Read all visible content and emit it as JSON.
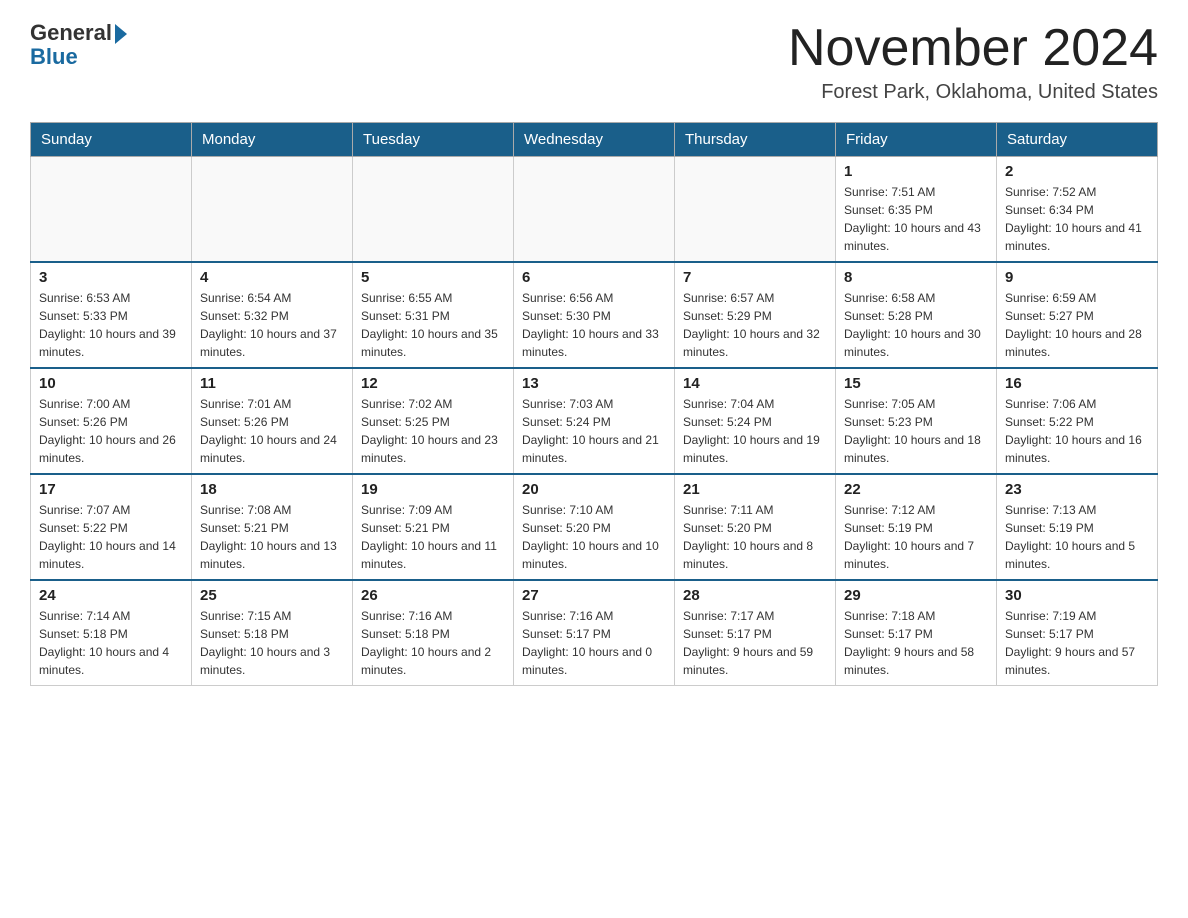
{
  "logo": {
    "general": "General",
    "blue": "Blue"
  },
  "header": {
    "title": "November 2024",
    "location": "Forest Park, Oklahoma, United States"
  },
  "days_of_week": [
    "Sunday",
    "Monday",
    "Tuesday",
    "Wednesday",
    "Thursday",
    "Friday",
    "Saturday"
  ],
  "weeks": [
    [
      {
        "day": "",
        "sunrise": "",
        "sunset": "",
        "daylight": ""
      },
      {
        "day": "",
        "sunrise": "",
        "sunset": "",
        "daylight": ""
      },
      {
        "day": "",
        "sunrise": "",
        "sunset": "",
        "daylight": ""
      },
      {
        "day": "",
        "sunrise": "",
        "sunset": "",
        "daylight": ""
      },
      {
        "day": "",
        "sunrise": "",
        "sunset": "",
        "daylight": ""
      },
      {
        "day": "1",
        "sunrise": "Sunrise: 7:51 AM",
        "sunset": "Sunset: 6:35 PM",
        "daylight": "Daylight: 10 hours and 43 minutes."
      },
      {
        "day": "2",
        "sunrise": "Sunrise: 7:52 AM",
        "sunset": "Sunset: 6:34 PM",
        "daylight": "Daylight: 10 hours and 41 minutes."
      }
    ],
    [
      {
        "day": "3",
        "sunrise": "Sunrise: 6:53 AM",
        "sunset": "Sunset: 5:33 PM",
        "daylight": "Daylight: 10 hours and 39 minutes."
      },
      {
        "day": "4",
        "sunrise": "Sunrise: 6:54 AM",
        "sunset": "Sunset: 5:32 PM",
        "daylight": "Daylight: 10 hours and 37 minutes."
      },
      {
        "day": "5",
        "sunrise": "Sunrise: 6:55 AM",
        "sunset": "Sunset: 5:31 PM",
        "daylight": "Daylight: 10 hours and 35 minutes."
      },
      {
        "day": "6",
        "sunrise": "Sunrise: 6:56 AM",
        "sunset": "Sunset: 5:30 PM",
        "daylight": "Daylight: 10 hours and 33 minutes."
      },
      {
        "day": "7",
        "sunrise": "Sunrise: 6:57 AM",
        "sunset": "Sunset: 5:29 PM",
        "daylight": "Daylight: 10 hours and 32 minutes."
      },
      {
        "day": "8",
        "sunrise": "Sunrise: 6:58 AM",
        "sunset": "Sunset: 5:28 PM",
        "daylight": "Daylight: 10 hours and 30 minutes."
      },
      {
        "day": "9",
        "sunrise": "Sunrise: 6:59 AM",
        "sunset": "Sunset: 5:27 PM",
        "daylight": "Daylight: 10 hours and 28 minutes."
      }
    ],
    [
      {
        "day": "10",
        "sunrise": "Sunrise: 7:00 AM",
        "sunset": "Sunset: 5:26 PM",
        "daylight": "Daylight: 10 hours and 26 minutes."
      },
      {
        "day": "11",
        "sunrise": "Sunrise: 7:01 AM",
        "sunset": "Sunset: 5:26 PM",
        "daylight": "Daylight: 10 hours and 24 minutes."
      },
      {
        "day": "12",
        "sunrise": "Sunrise: 7:02 AM",
        "sunset": "Sunset: 5:25 PM",
        "daylight": "Daylight: 10 hours and 23 minutes."
      },
      {
        "day": "13",
        "sunrise": "Sunrise: 7:03 AM",
        "sunset": "Sunset: 5:24 PM",
        "daylight": "Daylight: 10 hours and 21 minutes."
      },
      {
        "day": "14",
        "sunrise": "Sunrise: 7:04 AM",
        "sunset": "Sunset: 5:24 PM",
        "daylight": "Daylight: 10 hours and 19 minutes."
      },
      {
        "day": "15",
        "sunrise": "Sunrise: 7:05 AM",
        "sunset": "Sunset: 5:23 PM",
        "daylight": "Daylight: 10 hours and 18 minutes."
      },
      {
        "day": "16",
        "sunrise": "Sunrise: 7:06 AM",
        "sunset": "Sunset: 5:22 PM",
        "daylight": "Daylight: 10 hours and 16 minutes."
      }
    ],
    [
      {
        "day": "17",
        "sunrise": "Sunrise: 7:07 AM",
        "sunset": "Sunset: 5:22 PM",
        "daylight": "Daylight: 10 hours and 14 minutes."
      },
      {
        "day": "18",
        "sunrise": "Sunrise: 7:08 AM",
        "sunset": "Sunset: 5:21 PM",
        "daylight": "Daylight: 10 hours and 13 minutes."
      },
      {
        "day": "19",
        "sunrise": "Sunrise: 7:09 AM",
        "sunset": "Sunset: 5:21 PM",
        "daylight": "Daylight: 10 hours and 11 minutes."
      },
      {
        "day": "20",
        "sunrise": "Sunrise: 7:10 AM",
        "sunset": "Sunset: 5:20 PM",
        "daylight": "Daylight: 10 hours and 10 minutes."
      },
      {
        "day": "21",
        "sunrise": "Sunrise: 7:11 AM",
        "sunset": "Sunset: 5:20 PM",
        "daylight": "Daylight: 10 hours and 8 minutes."
      },
      {
        "day": "22",
        "sunrise": "Sunrise: 7:12 AM",
        "sunset": "Sunset: 5:19 PM",
        "daylight": "Daylight: 10 hours and 7 minutes."
      },
      {
        "day": "23",
        "sunrise": "Sunrise: 7:13 AM",
        "sunset": "Sunset: 5:19 PM",
        "daylight": "Daylight: 10 hours and 5 minutes."
      }
    ],
    [
      {
        "day": "24",
        "sunrise": "Sunrise: 7:14 AM",
        "sunset": "Sunset: 5:18 PM",
        "daylight": "Daylight: 10 hours and 4 minutes."
      },
      {
        "day": "25",
        "sunrise": "Sunrise: 7:15 AM",
        "sunset": "Sunset: 5:18 PM",
        "daylight": "Daylight: 10 hours and 3 minutes."
      },
      {
        "day": "26",
        "sunrise": "Sunrise: 7:16 AM",
        "sunset": "Sunset: 5:18 PM",
        "daylight": "Daylight: 10 hours and 2 minutes."
      },
      {
        "day": "27",
        "sunrise": "Sunrise: 7:16 AM",
        "sunset": "Sunset: 5:17 PM",
        "daylight": "Daylight: 10 hours and 0 minutes."
      },
      {
        "day": "28",
        "sunrise": "Sunrise: 7:17 AM",
        "sunset": "Sunset: 5:17 PM",
        "daylight": "Daylight: 9 hours and 59 minutes."
      },
      {
        "day": "29",
        "sunrise": "Sunrise: 7:18 AM",
        "sunset": "Sunset: 5:17 PM",
        "daylight": "Daylight: 9 hours and 58 minutes."
      },
      {
        "day": "30",
        "sunrise": "Sunrise: 7:19 AM",
        "sunset": "Sunset: 5:17 PM",
        "daylight": "Daylight: 9 hours and 57 minutes."
      }
    ]
  ]
}
